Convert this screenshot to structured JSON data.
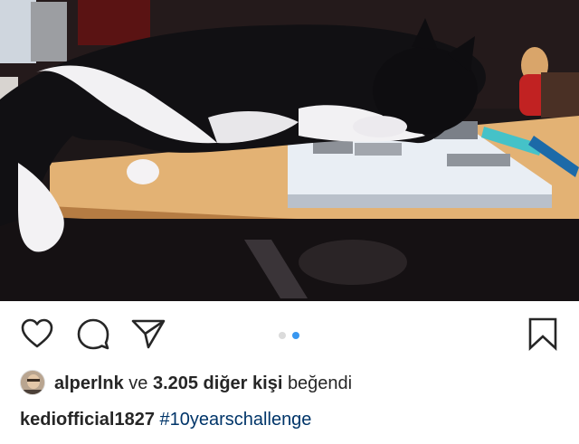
{
  "post": {
    "photo": {
      "alt_subject": "black-and-white cat lying on an open book on a wooden table",
      "colors": {
        "table": "#e3b274",
        "book": "#e9eef4",
        "cat_black": "#111013",
        "cat_white": "#f2f1f3"
      }
    },
    "actions": {
      "like_icon": "heart-outline-icon",
      "comment_icon": "comment-bubble-icon",
      "share_icon": "paper-plane-icon",
      "save_icon": "bookmark-outline-icon"
    },
    "carousel": {
      "total": 2,
      "active_index": 2,
      "active_color": "#3897f0",
      "inactive_color": "#dbdbdb"
    },
    "likes": {
      "first_user": "alperlnk",
      "connector": "ve",
      "count": "3.205 diğer kişi",
      "suffix": "beğendi"
    },
    "caption": {
      "username": "kediofficial1827",
      "hashtag": "#10yearschallenge"
    }
  }
}
